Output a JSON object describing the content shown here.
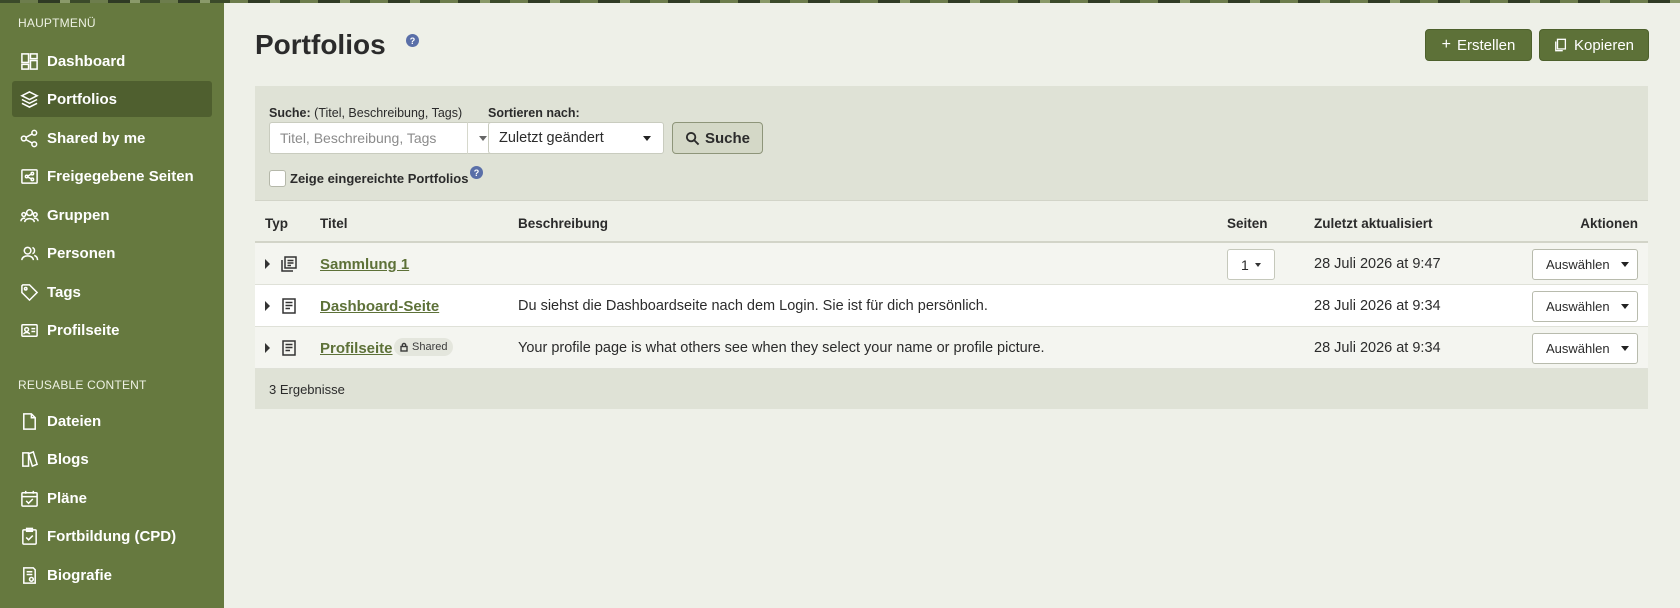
{
  "sidebar": {
    "main_heading": "HAUPTMENÜ",
    "main_items": [
      {
        "label": "Dashboard",
        "icon": "dashboard-icon"
      },
      {
        "label": "Portfolios",
        "icon": "layers-icon",
        "active": true
      },
      {
        "label": "Shared by me",
        "icon": "share-icon"
      },
      {
        "label": "Freigegebene Seiten",
        "icon": "shared-pages-icon"
      },
      {
        "label": "Gruppen",
        "icon": "groups-icon"
      },
      {
        "label": "Personen",
        "icon": "people-icon"
      },
      {
        "label": "Tags",
        "icon": "tag-icon"
      },
      {
        "label": "Profilseite",
        "icon": "profile-card-icon"
      }
    ],
    "reusable_heading": "REUSABLE CONTENT",
    "reusable_items": [
      {
        "label": "Dateien",
        "icon": "file-icon"
      },
      {
        "label": "Blogs",
        "icon": "blog-icon"
      },
      {
        "label": "Pläne",
        "icon": "calendar-check-icon"
      },
      {
        "label": "Fortbildung (CPD)",
        "icon": "clipboard-check-icon"
      },
      {
        "label": "Biografie",
        "icon": "resume-icon"
      }
    ]
  },
  "header": {
    "title": "Portfolios",
    "help": "?",
    "create_label": "Erstellen",
    "copy_label": "Kopieren"
  },
  "filter": {
    "search_label": "Suche:",
    "search_hint": "(Titel, Beschreibung, Tags)",
    "search_placeholder": "Titel, Beschreibung, Tags",
    "sort_label": "Sortieren nach:",
    "sort_value": "Zuletzt geändert",
    "search_button": "Suche",
    "checkbox_label": "Zeige eingereichte Portfolios",
    "help": "?"
  },
  "table": {
    "columns": [
      "Typ",
      "Titel",
      "Beschreibung",
      "Seiten",
      "Zuletzt aktualisiert",
      "Aktionen"
    ],
    "rows": [
      {
        "type_icon": "collection-icon",
        "title": "Sammlung 1",
        "description": "",
        "pages": "1",
        "updated": "28 Juli 2026 at 9:47",
        "action": "Auswählen"
      },
      {
        "type_icon": "page-icon",
        "title": "Dashboard-Seite",
        "description": "Du siehst die Dashboardseite nach dem Login. Sie ist für dich persönlich.",
        "pages": "",
        "updated": "28 Juli 2026 at 9:34",
        "action": "Auswählen"
      },
      {
        "type_icon": "page-icon",
        "title": "Profilseite",
        "badge": "Shared",
        "description": "Your profile page is what others see when they select your name or profile picture.",
        "pages": "",
        "updated": "28 Juli 2026 at 9:34",
        "action": "Auswählen"
      }
    ],
    "result_count": "3 Ergebnisse"
  },
  "colors": {
    "sidebar_bg": "#66793f",
    "accent": "#5d7138",
    "page_bg": "#eef0e8"
  }
}
